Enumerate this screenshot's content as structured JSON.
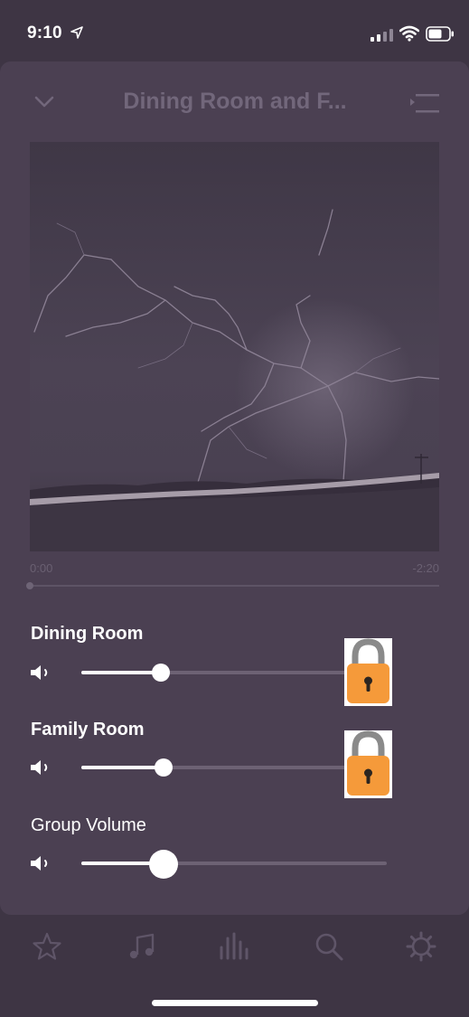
{
  "status_bar": {
    "time": "9:10"
  },
  "header": {
    "title": "Dining Room and F..."
  },
  "progress": {
    "elapsed": "0:00",
    "remaining": "-2:20",
    "fraction": 0.0
  },
  "rooms": [
    {
      "label": "Dining Room",
      "volume": 0.26,
      "locked": true
    },
    {
      "label": "Family Room",
      "volume": 0.27,
      "locked": true
    }
  ],
  "group": {
    "label": "Group Volume",
    "volume": 0.27
  },
  "icons": {
    "collapse": "chevron-down-icon",
    "queue": "queue-icon",
    "speaker": "speaker-icon",
    "lock": "lock-icon",
    "tabs": [
      "star-icon",
      "music-note-icon",
      "equalizer-icon",
      "search-icon",
      "gear-icon"
    ]
  },
  "colors": {
    "lock_body": "#f59a3a",
    "lock_shackle": "#8a8a8a",
    "background": "#4b4052"
  }
}
